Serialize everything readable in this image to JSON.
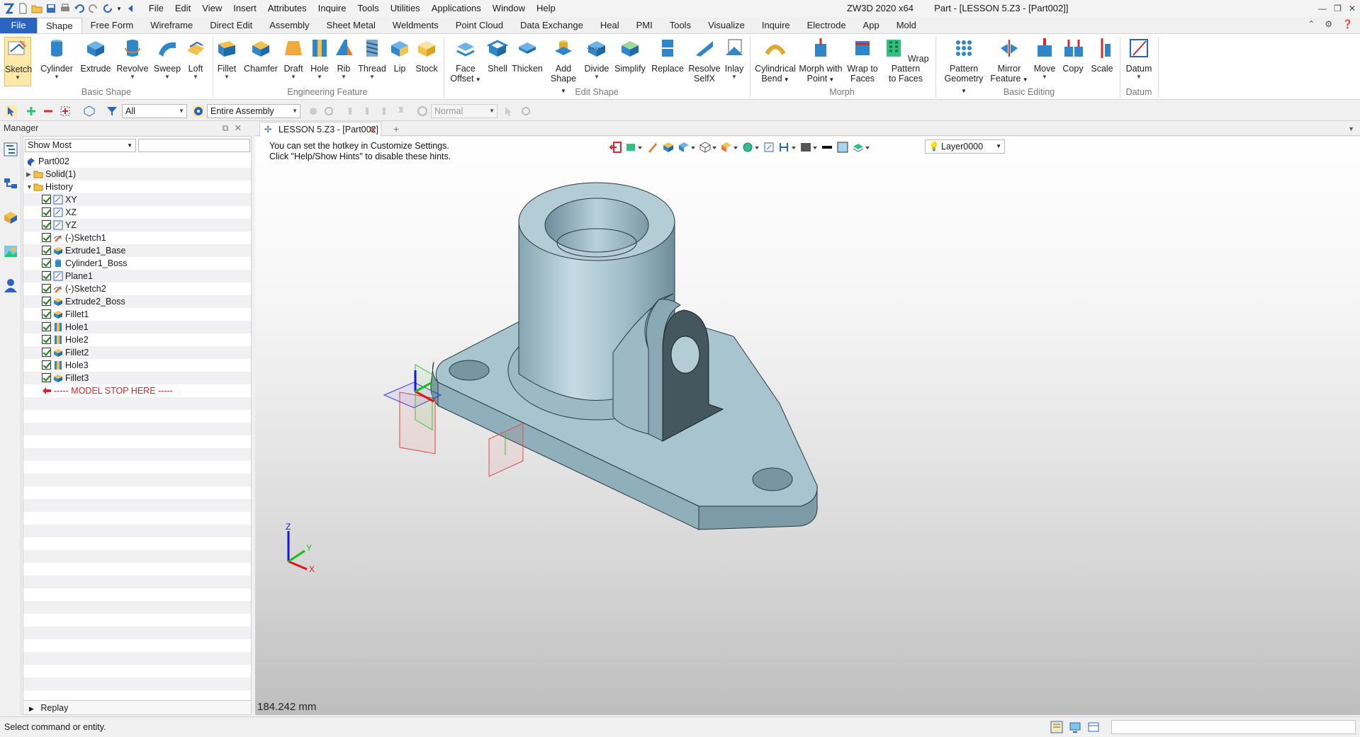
{
  "app": {
    "title": "ZW3D 2020 x64",
    "document_title": "Part - [LESSON 5.Z3 - [Part002]]"
  },
  "menubar": [
    "File",
    "Edit",
    "View",
    "Insert",
    "Attributes",
    "Inquire",
    "Tools",
    "Utilities",
    "Applications",
    "Window",
    "Help"
  ],
  "ribbon_tabs": {
    "file": "File",
    "tabs": [
      "Shape",
      "Free Form",
      "Wireframe",
      "Direct Edit",
      "Assembly",
      "Sheet Metal",
      "Weldments",
      "Point Cloud",
      "Data Exchange",
      "Heal",
      "PMI",
      "Tools",
      "Visualize",
      "Inquire",
      "Electrode",
      "App",
      "Mold"
    ],
    "active": "Shape"
  },
  "ribbon": {
    "groups": {
      "basic_shape": "Basic Shape",
      "engineering_feature": "Engineering Feature",
      "edit_shape": "Edit Shape",
      "morph": "Morph",
      "basic_editing": "Basic Editing",
      "datum": "Datum"
    },
    "buttons": {
      "sketch": "Sketch",
      "cylinder": "Cylinder",
      "extrude": "Extrude",
      "revolve": "Revolve",
      "sweep": "Sweep",
      "loft": "Loft",
      "fillet": "Fillet",
      "chamfer": "Chamfer",
      "draft": "Draft",
      "hole": "Hole",
      "rib": "Rib",
      "thread": "Thread",
      "lip": "Lip",
      "stock": "Stock",
      "face_offset_1": "Face",
      "face_offset_2": "Offset",
      "shell": "Shell",
      "thicken": "Thicken",
      "add_shape_1": "Add",
      "add_shape_2": "Shape",
      "divide": "Divide",
      "simplify": "Simplify",
      "replace": "Replace",
      "resolve_1": "Resolve",
      "resolve_2": "SelfX",
      "inlay": "Inlay",
      "cyl_bend_1": "Cylindrical",
      "cyl_bend_2": "Bend",
      "morph_point_1": "Morph with",
      "morph_point_2": "Point",
      "wrap_faces_1": "Wrap to",
      "wrap_faces_2": "Faces",
      "wrap_pattern_1": "Wrap Pattern",
      "wrap_pattern_2": "to Faces",
      "pattern_1": "Pattern",
      "pattern_2": "Geometry",
      "mirror_1": "Mirror",
      "mirror_2": "Feature",
      "move": "Move",
      "copy": "Copy",
      "scale": "Scale",
      "datum": "Datum"
    }
  },
  "toolbar": {
    "filter_value": "All",
    "scope_value": "Entire Assembly",
    "mode_value": "Normal"
  },
  "manager": {
    "title": "Manager",
    "filter_value": "Show Most",
    "replay": "Replay",
    "tree": [
      {
        "label": "Part002",
        "level": 0,
        "icon": "part-icon",
        "expand": ""
      },
      {
        "label": "Solid(1)",
        "level": 1,
        "icon": "folder-icon",
        "expand": "collapsed"
      },
      {
        "label": "History",
        "level": 1,
        "icon": "folder-icon",
        "expand": "expanded"
      },
      {
        "label": "XY",
        "level": 2,
        "icon": "plane-icon",
        "check": true
      },
      {
        "label": "XZ",
        "level": 2,
        "icon": "plane-icon",
        "check": true
      },
      {
        "label": "YZ",
        "level": 2,
        "icon": "plane-icon",
        "check": true
      },
      {
        "label": "(-)Sketch1",
        "level": 2,
        "icon": "sketch-icon",
        "check": true
      },
      {
        "label": "Extrude1_Base",
        "level": 2,
        "icon": "extrude-icon",
        "check": true
      },
      {
        "label": "Cylinder1_Boss",
        "level": 2,
        "icon": "cylinder-icon",
        "check": true
      },
      {
        "label": "Plane1",
        "level": 2,
        "icon": "plane-icon",
        "check": true
      },
      {
        "label": "(-)Sketch2",
        "level": 2,
        "icon": "sketch-icon",
        "check": true
      },
      {
        "label": "Extrude2_Boss",
        "level": 2,
        "icon": "extrude-icon",
        "check": true
      },
      {
        "label": "Fillet1",
        "level": 2,
        "icon": "fillet-icon",
        "check": true
      },
      {
        "label": "Hole1",
        "level": 2,
        "icon": "hole-icon",
        "check": true
      },
      {
        "label": "Hole2",
        "level": 2,
        "icon": "hole-icon",
        "check": true
      },
      {
        "label": "Fillet2",
        "level": 2,
        "icon": "fillet-icon",
        "check": true
      },
      {
        "label": "Hole3",
        "level": 2,
        "icon": "hole-icon",
        "check": true
      },
      {
        "label": "Fillet3",
        "level": 2,
        "icon": "fillet-icon",
        "check": true
      },
      {
        "label": "----- MODEL STOP HERE -----",
        "level": 2,
        "icon": "stop-arrow-icon",
        "stop": true
      }
    ]
  },
  "document_tab": {
    "label": "LESSON 5.Z3 - [Part002]",
    "close": "✕",
    "add": "+"
  },
  "viewport": {
    "hint_line1": "You can set the hotkey in Customize Settings.",
    "hint_line2": "Click \"Help/Show Hints\" to disable these hints.",
    "layer": "Layer0000",
    "scale": "184.242 mm",
    "triad": {
      "x": "X",
      "y": "Y",
      "z": "Z"
    }
  },
  "status": {
    "message": "Select command or entity."
  },
  "colors": {
    "accent": "#2b63c0",
    "model_face": "#a3bfc9",
    "stop_red": "#e0202a"
  }
}
